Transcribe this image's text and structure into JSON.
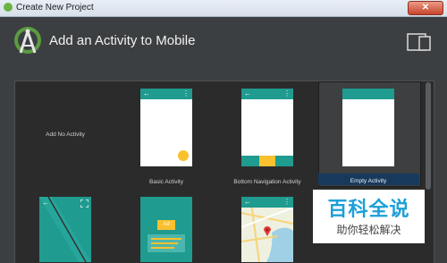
{
  "window": {
    "title": "Create New Project",
    "close_glyph": "✕"
  },
  "header": {
    "heading": "Add an Activity to Mobile",
    "icons": [
      "android-studio-logo",
      "device-form-factor-icon"
    ]
  },
  "gallery": {
    "add_no_activity": "Add No Activity",
    "tiles": [
      {
        "label": "Basic Activity"
      },
      {
        "label": "Bottom Navigation Activity"
      },
      {
        "label": "Empty Activity",
        "selected": true
      }
    ],
    "row2": {
      "ad_badge": "Ad"
    }
  },
  "colors": {
    "accent": "#1f9b8f",
    "fab": "#fbc02d",
    "selection": "#173a5c"
  },
  "watermark": {
    "main": "百科全说",
    "sub": "助你轻松解决"
  }
}
